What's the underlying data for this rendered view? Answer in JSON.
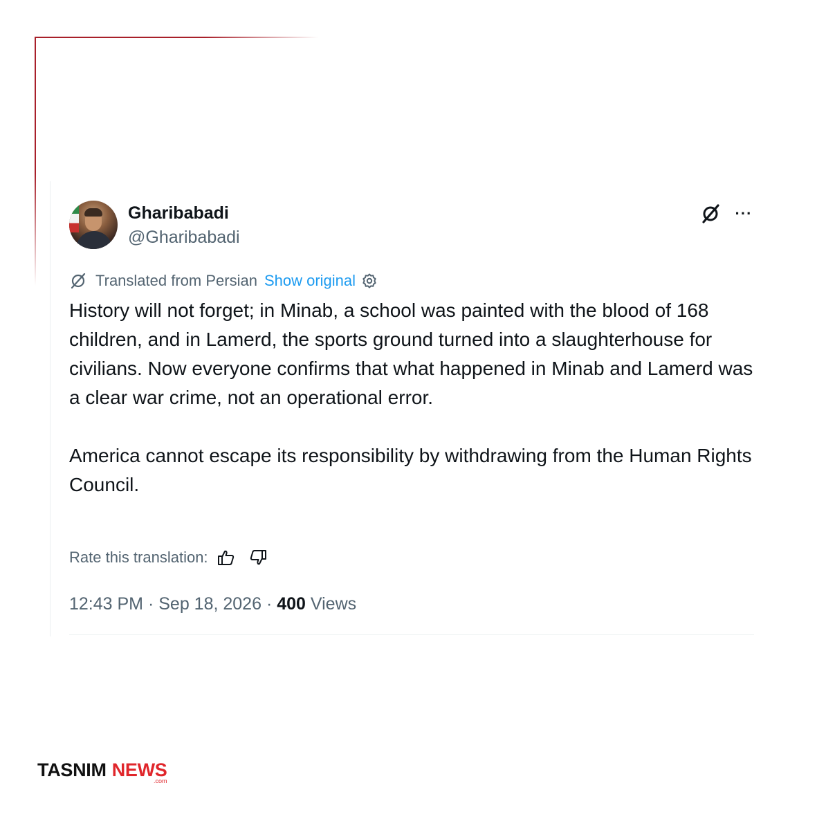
{
  "tweet": {
    "display_name": "Gharibabadi",
    "handle": "@Gharibabadi",
    "translation": {
      "label": "Translated from Persian",
      "show_original": "Show original"
    },
    "paragraphs": [
      "History will not forget; in Minab, a school was painted with the blood of 168 children, and in Lamerd, the sports ground turned into a slaughterhouse for civilians. Now everyone confirms that what happened in Minab and Lamerd was a clear war crime, not an operational error.",
      "America cannot escape its responsibility by withdrawing from the Human Rights Council."
    ],
    "rate_label": "Rate this translation:",
    "time": "12:43 PM",
    "separator": "·",
    "date": "Sep 18, 2026",
    "views_count": "400",
    "views_label": "Views",
    "more_label": "···"
  },
  "icons": {
    "grok": "grok-icon",
    "more": "more-icon",
    "translate": "translate-icon",
    "settings": "gear-icon",
    "like": "thumbs-up-icon",
    "dislike": "thumbs-down-icon"
  },
  "brand": {
    "tasnim": "TASNIM",
    "news": "NEWS",
    "domain": ".com"
  },
  "colors": {
    "accent": "#1d9bf0",
    "frame": "#a8202a",
    "brand_red": "#e0262b",
    "muted": "#536471",
    "text": "#0f1419"
  }
}
